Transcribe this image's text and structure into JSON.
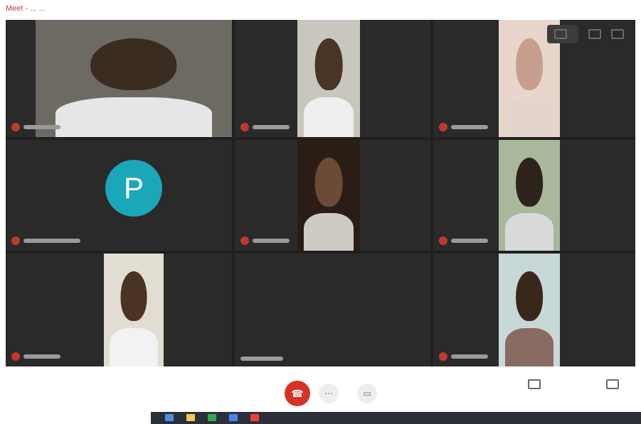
{
  "tab": {
    "title": "Meet - ... ..."
  },
  "top_controls": {
    "present_label": "",
    "chat_label": "",
    "activities_label": ""
  },
  "avatar": {
    "letter": "P"
  },
  "bottom": {
    "meeting_details_label": "",
    "leave_icon": "end-call-icon",
    "right_items": [
      {
        "label": ""
      },
      {
        "label": ""
      }
    ]
  },
  "colors": {
    "meeting_bg": "#1f1f1f",
    "tile_bg": "#2a2a2a",
    "mic_off": "#c0392b",
    "leave_red": "#d93025",
    "avatar_teal": "#1aa7b8"
  }
}
